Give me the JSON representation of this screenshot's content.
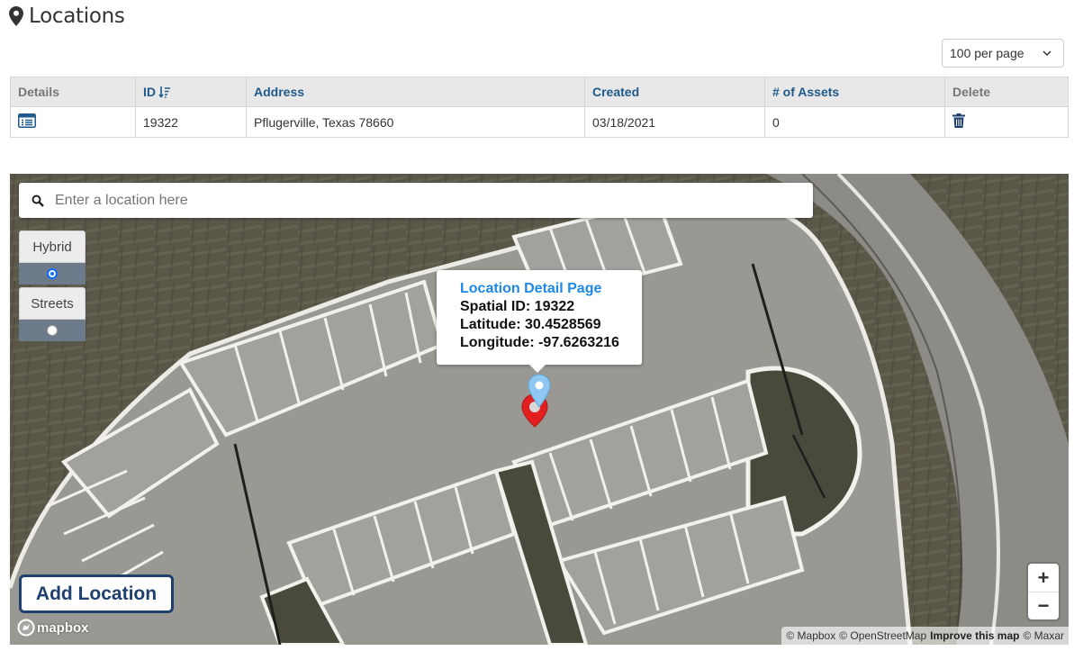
{
  "header": {
    "title": "Locations",
    "icon": "map-marker-icon"
  },
  "pagination": {
    "per_page": "100 per page"
  },
  "table": {
    "columns": [
      "Details",
      "ID",
      "Address",
      "Created",
      "# of Assets",
      "Delete"
    ],
    "rows": [
      {
        "id": "19322",
        "address": "Pflugerville, Texas 78660",
        "created": "03/18/2021",
        "assets": "0"
      }
    ]
  },
  "map": {
    "search_placeholder": "Enter a location here",
    "layers": {
      "hybrid": "Hybrid",
      "streets": "Streets",
      "selected": "Hybrid"
    },
    "popup": {
      "title": "Location Detail Page",
      "spatial_id": "Spatial ID: 19322",
      "latitude": "Latitude: 30.4528569",
      "longitude": "Longitude: -97.6263216"
    },
    "add_location": "Add Location",
    "zoom_in": "+",
    "zoom_out": "−",
    "logo": "mapbox",
    "attribution": {
      "mapbox": "© Mapbox",
      "osm": "© OpenStreetMap",
      "improve": "Improve this map",
      "maxar": "© Maxar"
    }
  },
  "colors": {
    "header_link": "#1f5a8a",
    "popup_link": "#1e88e5",
    "button_border": "#1f3f6e",
    "marker_red": "#e32020",
    "marker_blue": "#8ec8f2"
  }
}
